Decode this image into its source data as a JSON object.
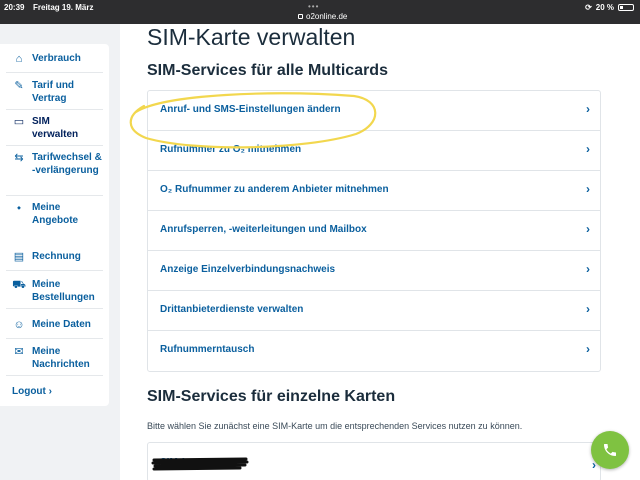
{
  "status_bar": {
    "time": "20:39",
    "date": "Freitag 19. März",
    "url": "o2online.de",
    "battery": "20 %",
    "dots": "•••"
  },
  "sidebar": {
    "items": [
      {
        "label": "Verbrauch",
        "icon": "home-icon"
      },
      {
        "label": "Tarif und Vertrag",
        "icon": "pen-icon"
      },
      {
        "label": "SIM verwalten",
        "icon": "sim-card-icon",
        "active": true
      },
      {
        "label": "Tarifwechsel & -verlängerung",
        "icon": "swap-icon"
      },
      {
        "label": "Meine Angebote",
        "icon": "tag-icon"
      }
    ],
    "items2": [
      {
        "label": "Rechnung",
        "icon": "invoice-icon"
      },
      {
        "label": "Meine Bestellungen",
        "icon": "cart-icon"
      },
      {
        "label": "Meine Daten",
        "icon": "user-icon"
      },
      {
        "label": "Meine Nachrichten",
        "icon": "messages-icon"
      }
    ],
    "logout": "Logout ›"
  },
  "main": {
    "title": "SIM-Karte verwalten",
    "section1": "SIM-Services für alle Multicards",
    "services": [
      "Anruf- und SMS-Einstellungen ändern",
      "Rufnummer zu O₂ mitnehmen",
      "O₂ Rufnummer zu anderem Anbieter mitnehmen",
      "Anrufsperren, -weiterleitungen und Mailbox",
      "Anzeige Einzelverbindungsnachweis",
      "Drittanbieterdienste verwalten",
      "Rufnummerntausch"
    ],
    "section2": "SIM-Services für einzelne Karten",
    "hint": "Bitte wählen Sie zunächst eine SIM-Karte um die entsprechenden Services nutzen zu können.",
    "sim_card_label": "SIM 1",
    "chevron": "›"
  },
  "colors": {
    "link": "#0a5f9e",
    "highlight": "#f2d74e",
    "fab": "#7fc241"
  }
}
